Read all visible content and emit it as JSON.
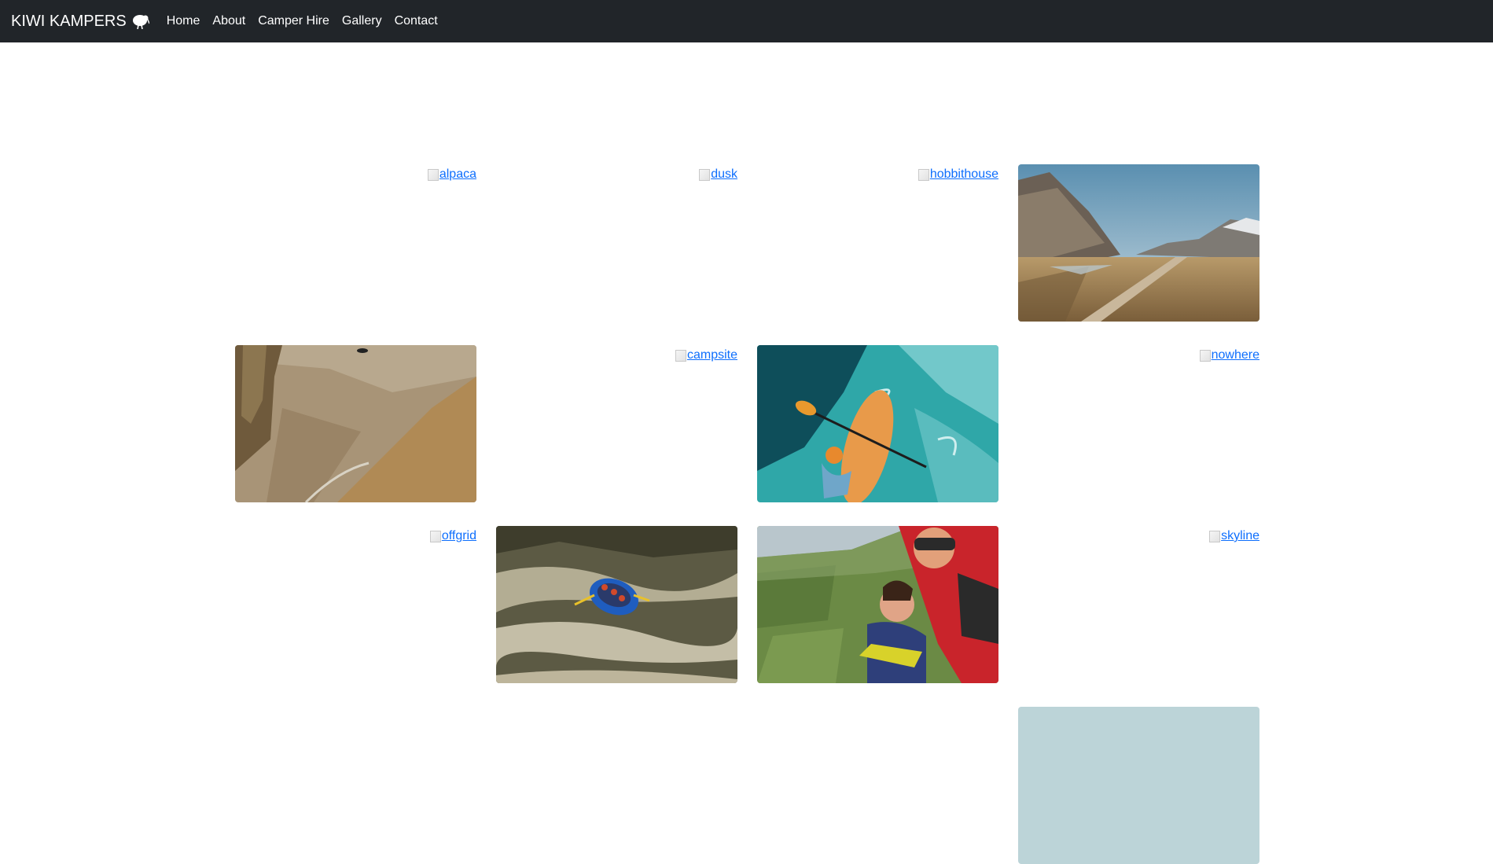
{
  "navbar": {
    "brand": "KIWI KAMPERS",
    "brand_icon": "kiwi-bird-icon",
    "links": [
      "Home",
      "About",
      "Camper Hire",
      "Gallery",
      "Contact"
    ]
  },
  "gallery": {
    "broken_images": {
      "alpaca": "alpaca",
      "dusk": "dusk",
      "hobbithouse": "hobbithouse",
      "campsite": "campsite",
      "nowhere": "nowhere",
      "offgrid": "offgrid",
      "skyline": "skyline"
    },
    "photos": [
      "boardwalk-valley",
      "canyon",
      "kayak",
      "rafting",
      "skydiving"
    ]
  }
}
